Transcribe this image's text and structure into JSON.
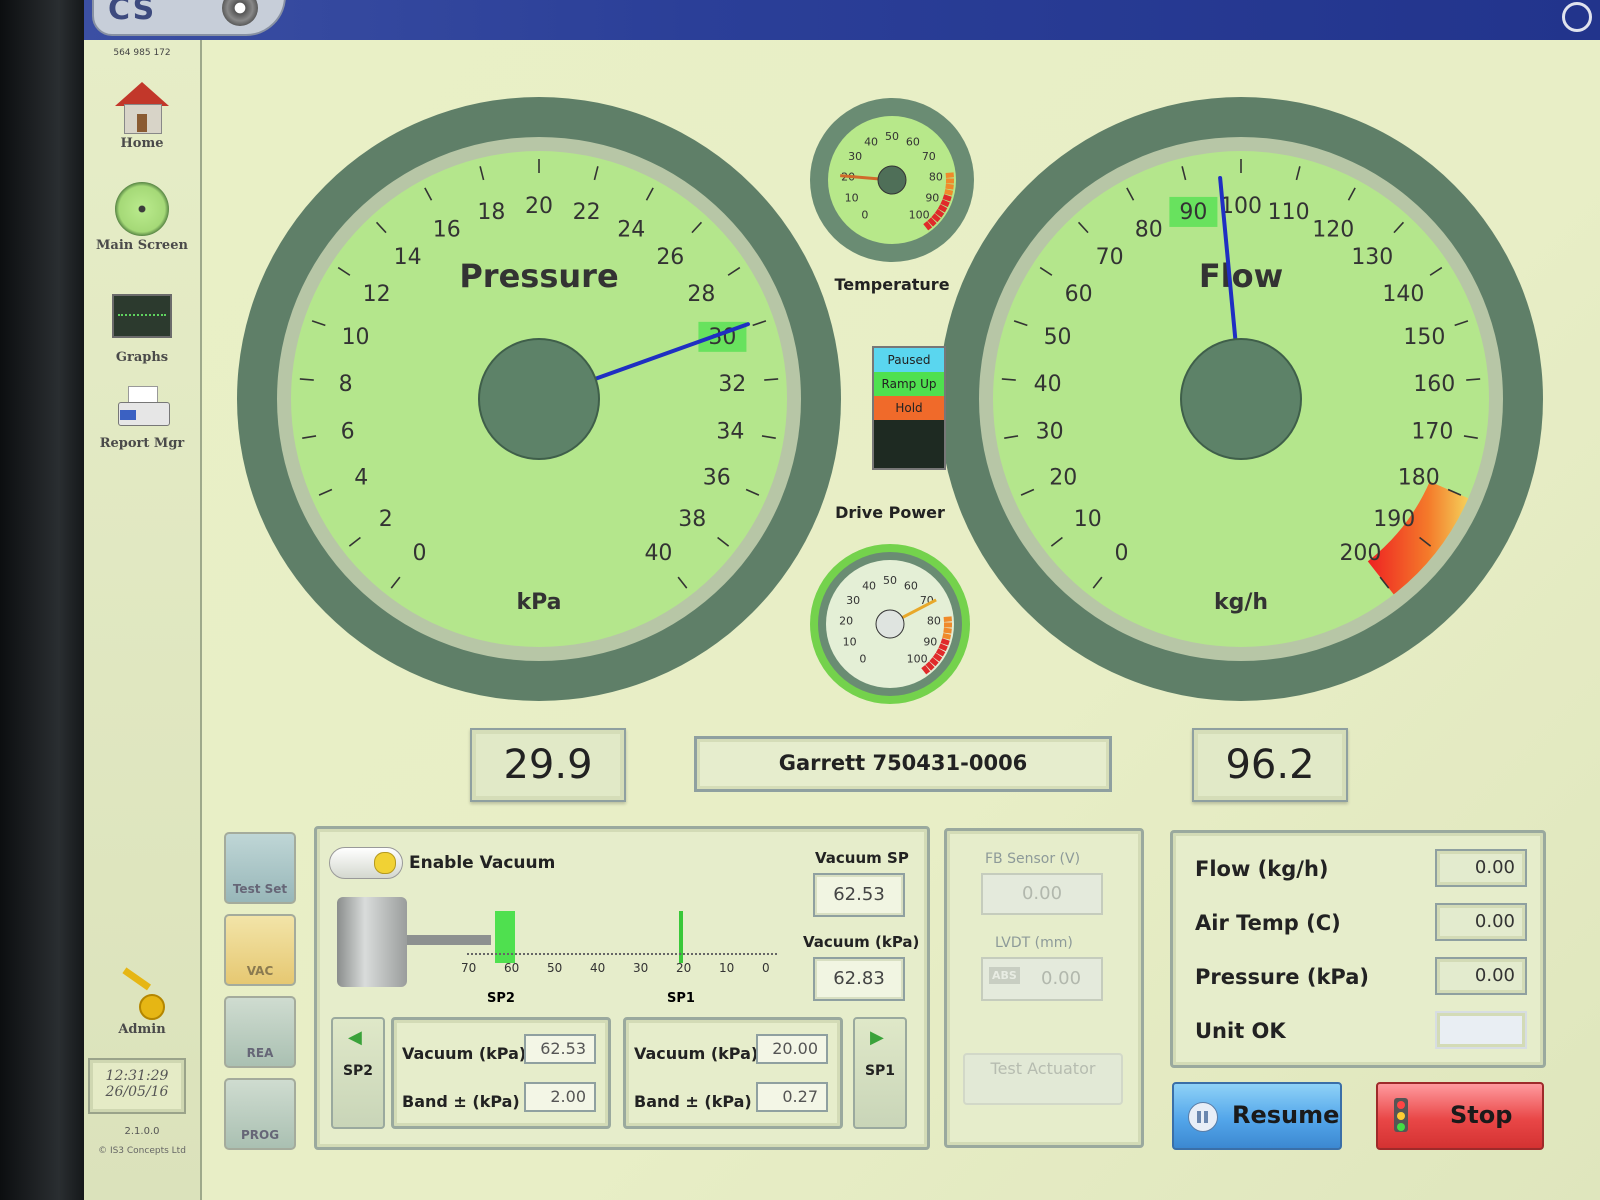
{
  "header": {
    "logo_text": "CS"
  },
  "sidebar": {
    "serial": "564 985 172",
    "items": [
      {
        "label": "Home",
        "icon": "home-icon"
      },
      {
        "label": "Main Screen",
        "icon": "gauge-icon"
      },
      {
        "label": "Graphs",
        "icon": "graph-icon"
      },
      {
        "label": "Report Mgr",
        "icon": "printer-icon"
      }
    ],
    "admin": {
      "label": "Admin",
      "icon": "key-icon"
    },
    "clock": {
      "time": "12:31:29",
      "date": "26/05/16"
    },
    "version": "2.1.0.0",
    "copyright": "© IS3 Concepts Ltd"
  },
  "gauges": {
    "pressure": {
      "title": "Pressure",
      "unit": "kPa",
      "value": 29.9,
      "setpoint": 30,
      "ticks": [
        "0",
        "2",
        "4",
        "6",
        "8",
        "10",
        "12",
        "14",
        "16",
        "18",
        "20",
        "22",
        "24",
        "26",
        "28",
        "30",
        "32",
        "34",
        "36",
        "38",
        "40"
      ]
    },
    "flow": {
      "title": "Flow",
      "unit": "kg/h",
      "value": 96.2,
      "setpoint": 90,
      "ticks": [
        "0",
        "10",
        "20",
        "30",
        "40",
        "50",
        "60",
        "70",
        "80",
        "90",
        "100",
        "110",
        "120",
        "130",
        "140",
        "150",
        "160",
        "170",
        "180",
        "190",
        "200"
      ]
    },
    "temperature": {
      "title": "Temperature",
      "value": 20,
      "ticks": [
        "0",
        "10",
        "20",
        "30",
        "40",
        "50",
        "60",
        "70",
        "80",
        "90",
        "100"
      ]
    },
    "drive_power": {
      "title": "Drive Power",
      "value": 72,
      "ticks": [
        "0",
        "10",
        "20",
        "30",
        "40",
        "50",
        "60",
        "70",
        "80",
        "90",
        "100"
      ]
    }
  },
  "readouts": {
    "pressure_value": "29.9",
    "flow_value": "96.2",
    "product_name": "Garrett 750431-0006"
  },
  "status": [
    {
      "label": "Paused",
      "color": "#5ad6ef"
    },
    {
      "label": "Ramp Up",
      "color": "#4fe04f"
    },
    {
      "label": "Hold",
      "color": "#f06a2a"
    },
    {
      "label": "",
      "color": "#1e2a22"
    },
    {
      "label": "",
      "color": "#1e2a22"
    }
  ],
  "side_buttons": [
    {
      "label": "Test Set"
    },
    {
      "label": "VAC"
    },
    {
      "label": "REA"
    },
    {
      "label": "PROG"
    }
  ],
  "vacuum": {
    "toggle_label": "Enable Vacuum",
    "sp_label": "Vacuum SP",
    "sp_value": "62.53",
    "actual_label": "Vacuum (kPa)",
    "actual_value": "62.83",
    "scale_ticks": [
      "70",
      "60",
      "50",
      "40",
      "30",
      "20",
      "10",
      "0"
    ],
    "sp2_marker": "SP2",
    "sp1_marker": "SP1",
    "sp2": {
      "button": "SP2",
      "vac_label": "Vacuum (kPa)",
      "vac_value": "62.53",
      "band_label": "Band ± (kPa)",
      "band_value": "2.00"
    },
    "sp1": {
      "button": "SP1",
      "vac_label": "Vacuum (kPa)",
      "vac_value": "20.00",
      "band_label": "Band ± (kPa)",
      "band_value": "0.27"
    }
  },
  "sensor": {
    "fb_label": "FB Sensor (V)",
    "fb_value": "0.00",
    "lvdt_label": "LVDT (mm)",
    "lvdt_abs": "ABS",
    "lvdt_value": "0.00",
    "test_button": "Test Actuator"
  },
  "live": [
    {
      "label": "Flow (kg/h)",
      "value": "0.00"
    },
    {
      "label": "Air Temp (C)",
      "value": "0.00"
    },
    {
      "label": "Pressure (kPa)",
      "value": "0.00"
    },
    {
      "label": "Unit OK",
      "value": ""
    }
  ],
  "actions": {
    "resume": "Resume",
    "stop": "Stop"
  }
}
